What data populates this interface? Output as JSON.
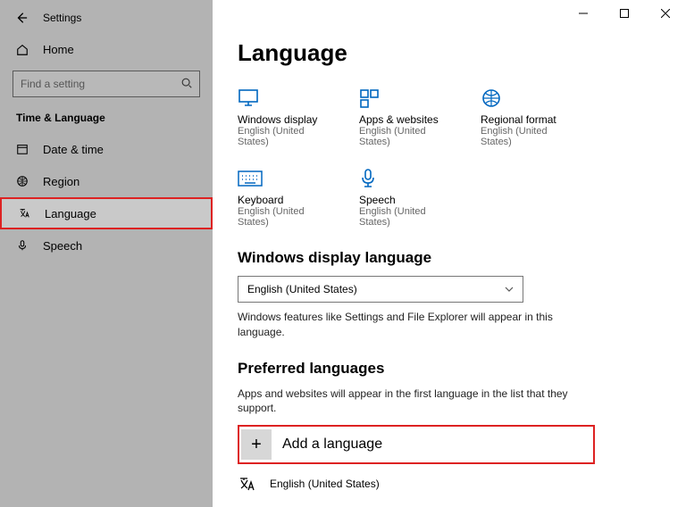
{
  "window": {
    "title": "Settings"
  },
  "home": {
    "label": "Home"
  },
  "search": {
    "placeholder": "Find a setting"
  },
  "section": {
    "label": "Time & Language"
  },
  "nav": {
    "items": [
      {
        "label": "Date & time"
      },
      {
        "label": "Region"
      },
      {
        "label": "Language"
      },
      {
        "label": "Speech"
      }
    ]
  },
  "page": {
    "title": "Language"
  },
  "tiles": [
    {
      "title": "Windows display",
      "sub": "English (United States)"
    },
    {
      "title": "Apps & websites",
      "sub": "English (United States)"
    },
    {
      "title": "Regional format",
      "sub": "English (United States)"
    },
    {
      "title": "Keyboard",
      "sub": "English (United States)"
    },
    {
      "title": "Speech",
      "sub": "English (United States)"
    }
  ],
  "displayLang": {
    "heading": "Windows display language",
    "selected": "English (United States)",
    "helper": "Windows features like Settings and File Explorer will appear in this language."
  },
  "preferred": {
    "heading": "Preferred languages",
    "helper": "Apps and websites will appear in the first language in the list that they support.",
    "addLabel": "Add a language",
    "items": [
      {
        "label": "English (United States)"
      }
    ]
  }
}
